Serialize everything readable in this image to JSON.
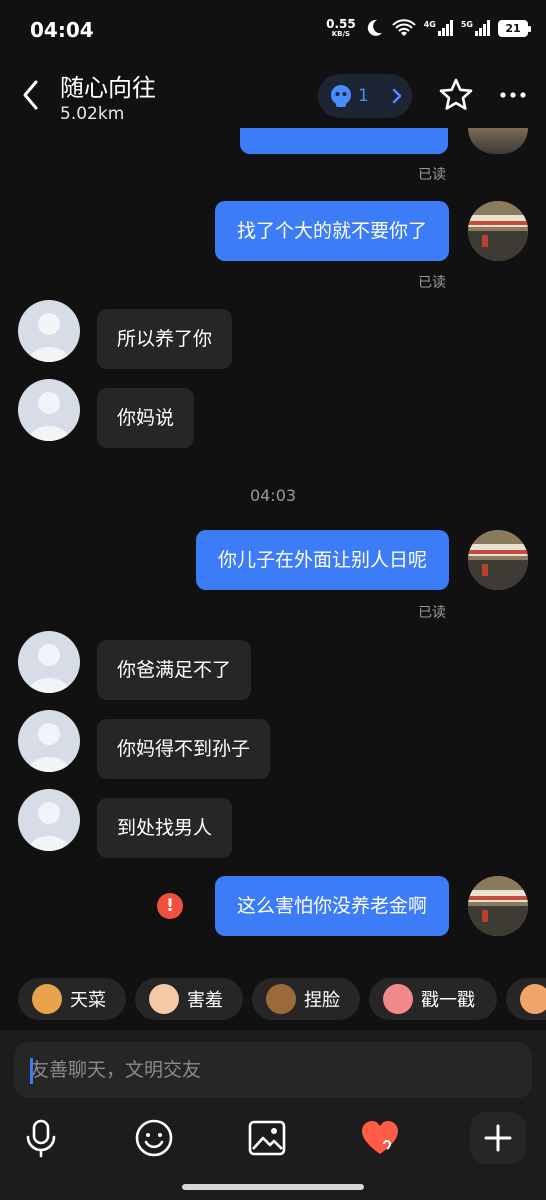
{
  "status": {
    "time": "04:04",
    "netspeed_value": "0.55",
    "netspeed_unit": "KB/S",
    "sig1_label": "4G",
    "sig2_label": "5G",
    "battery": "21"
  },
  "header": {
    "title": "随心向往",
    "distance": "5.02km",
    "pill_count": "1"
  },
  "messages": {
    "read_label": "已读",
    "out_1": "找了个大的就不要你了",
    "in_1": "所以养了你",
    "in_2": "你妈说",
    "time_sep": "04:03",
    "out_2": "你儿子在外面让别人日呢",
    "in_3": "你爸满足不了",
    "in_4": "你妈得不到孙子",
    "in_5": "到处找男人",
    "out_3": "这么害怕你没养老金啊",
    "error_mark": "!"
  },
  "chips": [
    "天菜",
    "害羞",
    "捏脸",
    "戳一戳"
  ],
  "input": {
    "placeholder": "友善聊天，文明交友"
  },
  "colors": {
    "accent": "#3d7cf7",
    "error": "#f1503f",
    "background": "#111111"
  },
  "icons": [
    "back-arrow-icon",
    "robot-icon",
    "chevron-right-icon",
    "star-icon",
    "more-icon",
    "mic-icon",
    "emoji-icon",
    "image-icon",
    "heart-gift-icon",
    "plus-icon"
  ]
}
